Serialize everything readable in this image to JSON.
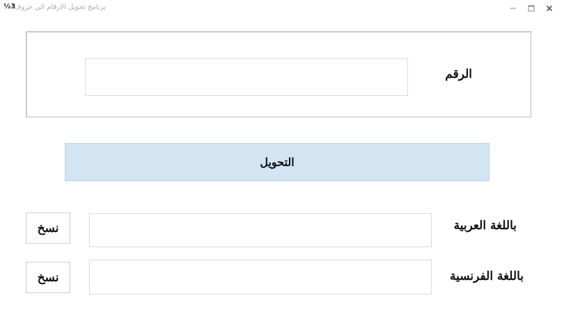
{
  "window": {
    "title": "برنامج تحويل الارقام الى حروف",
    "icon_glyph": "½3"
  },
  "number_group": {
    "label": "الرقم",
    "input_value": ""
  },
  "convert_button": {
    "label": "التحويل"
  },
  "arabic_output": {
    "label": "باللغة العربية",
    "value": "",
    "copy_label": "نسخ"
  },
  "french_output": {
    "label": "باللغة الفرنسية",
    "value": "",
    "copy_label": "نسخ"
  },
  "icons": {
    "app": "fraction-icon",
    "close": "close-icon",
    "maximize": "maximize-icon",
    "minimize": "minimize-icon"
  }
}
